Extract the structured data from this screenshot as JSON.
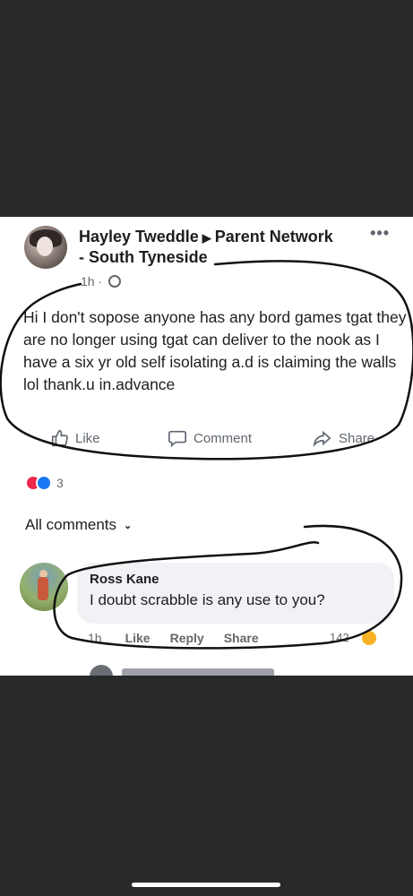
{
  "post": {
    "author": "Hayley Tweddle",
    "group_line1": "Parent Network",
    "group_line2": "- South Tyneside",
    "time": "1h",
    "text": "Hi I don't sopose anyone has any bord games tgat they are no longer using tgat can deliver to the nook as I have a six yr old self isolating a.d is claiming the walls lol  thank.u in.advance",
    "more_icon": "more-dots-icon",
    "privacy_icon": "globe-icon"
  },
  "actions": {
    "like": "Like",
    "comment": "Comment",
    "share": "Share"
  },
  "reactions": {
    "count": "3",
    "types": [
      "love",
      "like"
    ]
  },
  "comments": {
    "filter_label": "All comments",
    "items": [
      {
        "name": "Ross Kane",
        "text": "I doubt scrabble is any use to you?",
        "time": "1h",
        "like": "Like",
        "reply": "Reply",
        "share": "Share",
        "reaction_count": "142"
      }
    ]
  },
  "colors": {
    "background": "#27292b",
    "card": "#ffffff",
    "annotation": "#111111",
    "bubble": "#f0f2f5"
  }
}
